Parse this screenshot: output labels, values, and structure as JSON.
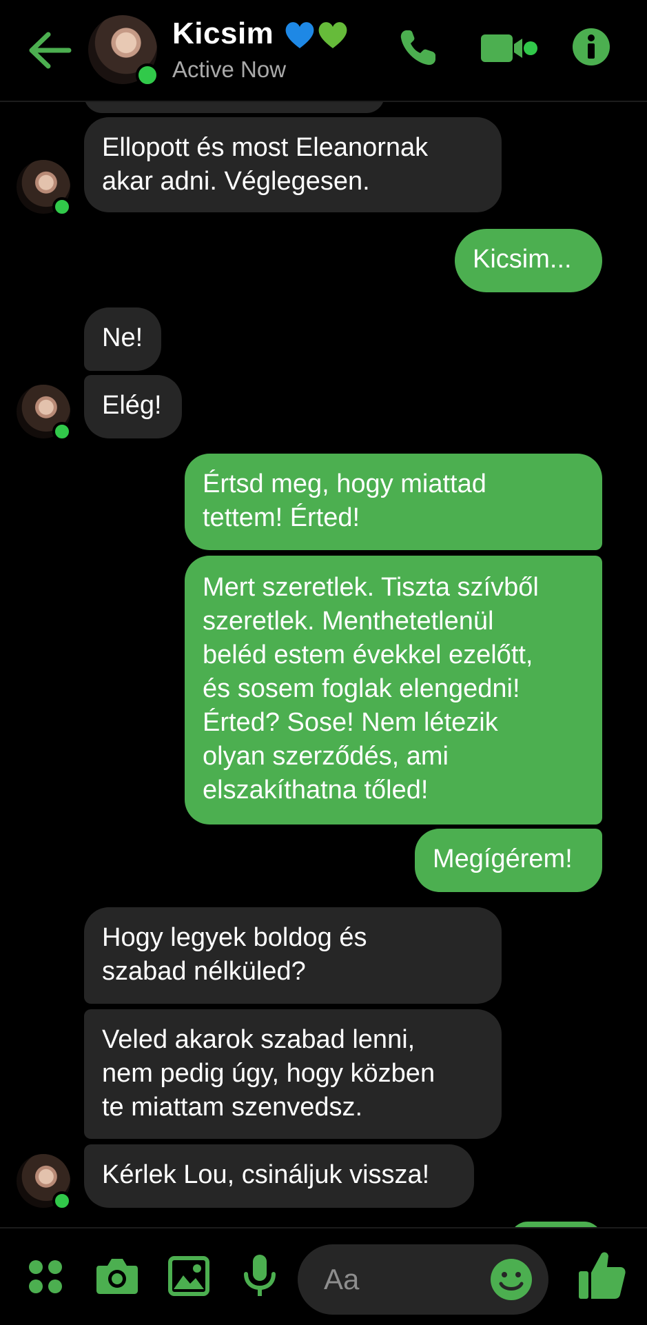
{
  "header": {
    "back_icon": "arrow-left-icon",
    "contact_name": "Kicsim",
    "status": "Active Now",
    "accent_color": "#4caf50",
    "call_icon": "phone-icon",
    "video_icon": "video-camera-icon",
    "info_icon": "info-icon"
  },
  "messages": [
    {
      "from": "them",
      "lines": [
        "Ellopott és most Eleanornak",
        "akar adni. Véglegesen."
      ]
    },
    {
      "from": "me",
      "lines": [
        "Kicsim..."
      ]
    },
    {
      "from": "them",
      "lines": [
        "Ne!"
      ]
    },
    {
      "from": "them",
      "lines": [
        "Elég!"
      ]
    },
    {
      "from": "me",
      "lines": [
        "Értsd meg, hogy miattad",
        "tettem! Érted!"
      ]
    },
    {
      "from": "me",
      "lines": [
        "Mert szeretlek. Tiszta szívből",
        "szeretlek. Menthetetlenül",
        "beléd estem évekkel ezelőtt,",
        "és sosem foglak elengedni!",
        "Érted? Sose! Nem létezik",
        "olyan szerződés, ami",
        "elszakíthatna tőled!"
      ]
    },
    {
      "from": "me",
      "lines": [
        "Megígérem!"
      ]
    },
    {
      "from": "them",
      "lines": [
        "Hogy legyek boldog és",
        "szabad nélküled?"
      ]
    },
    {
      "from": "them",
      "lines": [
        "Veled akarok szabad lenni,",
        "nem pedig úgy, hogy közben",
        "te miattam szenvedsz."
      ]
    },
    {
      "from": "them",
      "lines": [
        "Kérlek Lou, csináljuk vissza!"
      ]
    }
  ],
  "composer": {
    "placeholder": "Aa",
    "menu_icon": "four-dots-menu-icon",
    "camera_icon": "camera-icon",
    "gallery_icon": "image-icon",
    "mic_icon": "microphone-icon",
    "emoji_icon": "smiley-icon",
    "like_icon": "thumbs-up-icon"
  }
}
